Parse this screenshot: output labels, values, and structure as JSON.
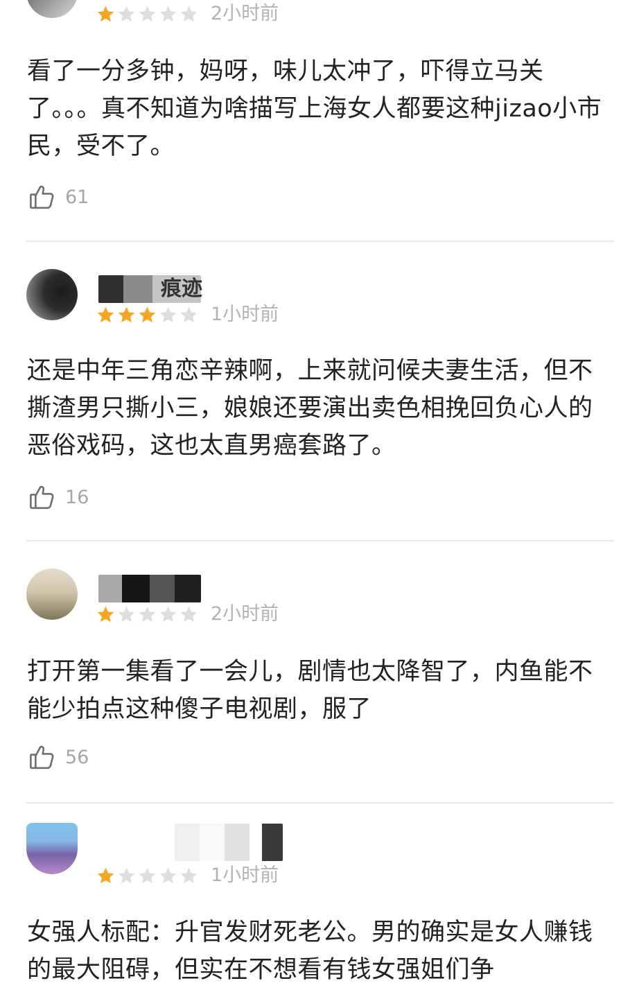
{
  "reviews": [
    {
      "rating": 1,
      "max_rating": 5,
      "time": "2小时前",
      "content": "看了一分多钟，妈呀，味儿太冲了，吓得立马关了。。。真不知道为啥描写上海女人都要这种jizao小市民，受不了。",
      "likes": "61",
      "username_visible": ""
    },
    {
      "rating": 3,
      "max_rating": 5,
      "time": "1小时前",
      "content": "还是中年三角恋辛辣啊，上来就问候夫妻生活，但不撕渣男只撕小三，娘娘还要演出卖色相挽回负心人的恶俗戏码，这也太直男癌套路了。",
      "likes": "16",
      "username_visible": "痕迹"
    },
    {
      "rating": 1,
      "max_rating": 5,
      "time": "2小时前",
      "content": "打开第一集看了一会儿，剧情也太降智了，内鱼能不能少拍点这种傻子电视剧，服了",
      "likes": "56",
      "username_visible": ""
    },
    {
      "rating": 1,
      "max_rating": 5,
      "time": "1小时前",
      "content": "女强人标配：升官发财死老公。男的确实是女人赚钱的最大阻碍，但实在不想看有钱女强姐们争",
      "likes": "",
      "username_visible": ""
    }
  ],
  "colors": {
    "star_filled": "#f5a623",
    "star_empty": "#dedede",
    "time_text": "#b3b3b3",
    "like_text": "#a6a6a6",
    "divider": "#e9e9e9",
    "body_text": "#222222"
  },
  "icons": {
    "like": "thumbs-up-outline-icon",
    "star": "star-icon"
  }
}
